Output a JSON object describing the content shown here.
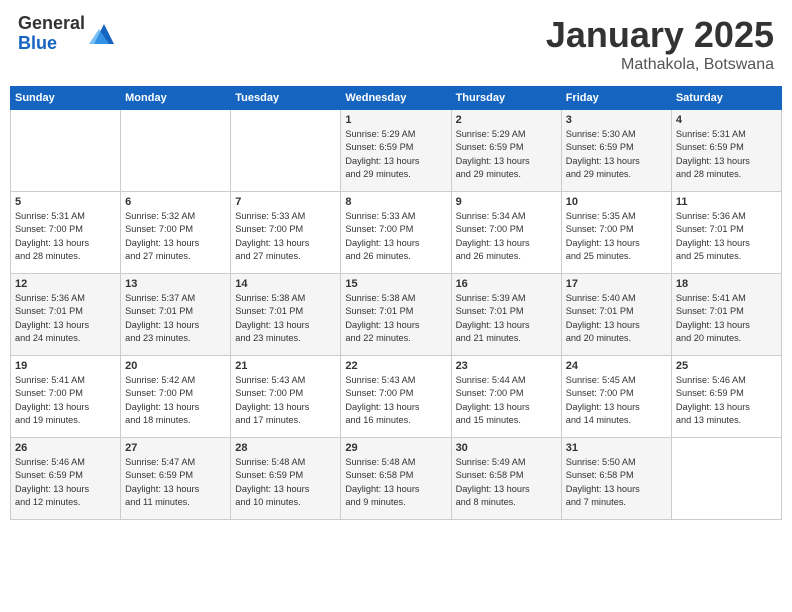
{
  "header": {
    "logo_general": "General",
    "logo_blue": "Blue",
    "month_year": "January 2025",
    "location": "Mathakola, Botswana"
  },
  "days_of_week": [
    "Sunday",
    "Monday",
    "Tuesday",
    "Wednesday",
    "Thursday",
    "Friday",
    "Saturday"
  ],
  "weeks": [
    [
      {
        "day": "",
        "info": ""
      },
      {
        "day": "",
        "info": ""
      },
      {
        "day": "",
        "info": ""
      },
      {
        "day": "1",
        "info": "Sunrise: 5:29 AM\nSunset: 6:59 PM\nDaylight: 13 hours\nand 29 minutes."
      },
      {
        "day": "2",
        "info": "Sunrise: 5:29 AM\nSunset: 6:59 PM\nDaylight: 13 hours\nand 29 minutes."
      },
      {
        "day": "3",
        "info": "Sunrise: 5:30 AM\nSunset: 6:59 PM\nDaylight: 13 hours\nand 29 minutes."
      },
      {
        "day": "4",
        "info": "Sunrise: 5:31 AM\nSunset: 6:59 PM\nDaylight: 13 hours\nand 28 minutes."
      }
    ],
    [
      {
        "day": "5",
        "info": "Sunrise: 5:31 AM\nSunset: 7:00 PM\nDaylight: 13 hours\nand 28 minutes."
      },
      {
        "day": "6",
        "info": "Sunrise: 5:32 AM\nSunset: 7:00 PM\nDaylight: 13 hours\nand 27 minutes."
      },
      {
        "day": "7",
        "info": "Sunrise: 5:33 AM\nSunset: 7:00 PM\nDaylight: 13 hours\nand 27 minutes."
      },
      {
        "day": "8",
        "info": "Sunrise: 5:33 AM\nSunset: 7:00 PM\nDaylight: 13 hours\nand 26 minutes."
      },
      {
        "day": "9",
        "info": "Sunrise: 5:34 AM\nSunset: 7:00 PM\nDaylight: 13 hours\nand 26 minutes."
      },
      {
        "day": "10",
        "info": "Sunrise: 5:35 AM\nSunset: 7:00 PM\nDaylight: 13 hours\nand 25 minutes."
      },
      {
        "day": "11",
        "info": "Sunrise: 5:36 AM\nSunset: 7:01 PM\nDaylight: 13 hours\nand 25 minutes."
      }
    ],
    [
      {
        "day": "12",
        "info": "Sunrise: 5:36 AM\nSunset: 7:01 PM\nDaylight: 13 hours\nand 24 minutes."
      },
      {
        "day": "13",
        "info": "Sunrise: 5:37 AM\nSunset: 7:01 PM\nDaylight: 13 hours\nand 23 minutes."
      },
      {
        "day": "14",
        "info": "Sunrise: 5:38 AM\nSunset: 7:01 PM\nDaylight: 13 hours\nand 23 minutes."
      },
      {
        "day": "15",
        "info": "Sunrise: 5:38 AM\nSunset: 7:01 PM\nDaylight: 13 hours\nand 22 minutes."
      },
      {
        "day": "16",
        "info": "Sunrise: 5:39 AM\nSunset: 7:01 PM\nDaylight: 13 hours\nand 21 minutes."
      },
      {
        "day": "17",
        "info": "Sunrise: 5:40 AM\nSunset: 7:01 PM\nDaylight: 13 hours\nand 20 minutes."
      },
      {
        "day": "18",
        "info": "Sunrise: 5:41 AM\nSunset: 7:01 PM\nDaylight: 13 hours\nand 20 minutes."
      }
    ],
    [
      {
        "day": "19",
        "info": "Sunrise: 5:41 AM\nSunset: 7:00 PM\nDaylight: 13 hours\nand 19 minutes."
      },
      {
        "day": "20",
        "info": "Sunrise: 5:42 AM\nSunset: 7:00 PM\nDaylight: 13 hours\nand 18 minutes."
      },
      {
        "day": "21",
        "info": "Sunrise: 5:43 AM\nSunset: 7:00 PM\nDaylight: 13 hours\nand 17 minutes."
      },
      {
        "day": "22",
        "info": "Sunrise: 5:43 AM\nSunset: 7:00 PM\nDaylight: 13 hours\nand 16 minutes."
      },
      {
        "day": "23",
        "info": "Sunrise: 5:44 AM\nSunset: 7:00 PM\nDaylight: 13 hours\nand 15 minutes."
      },
      {
        "day": "24",
        "info": "Sunrise: 5:45 AM\nSunset: 7:00 PM\nDaylight: 13 hours\nand 14 minutes."
      },
      {
        "day": "25",
        "info": "Sunrise: 5:46 AM\nSunset: 6:59 PM\nDaylight: 13 hours\nand 13 minutes."
      }
    ],
    [
      {
        "day": "26",
        "info": "Sunrise: 5:46 AM\nSunset: 6:59 PM\nDaylight: 13 hours\nand 12 minutes."
      },
      {
        "day": "27",
        "info": "Sunrise: 5:47 AM\nSunset: 6:59 PM\nDaylight: 13 hours\nand 11 minutes."
      },
      {
        "day": "28",
        "info": "Sunrise: 5:48 AM\nSunset: 6:59 PM\nDaylight: 13 hours\nand 10 minutes."
      },
      {
        "day": "29",
        "info": "Sunrise: 5:48 AM\nSunset: 6:58 PM\nDaylight: 13 hours\nand 9 minutes."
      },
      {
        "day": "30",
        "info": "Sunrise: 5:49 AM\nSunset: 6:58 PM\nDaylight: 13 hours\nand 8 minutes."
      },
      {
        "day": "31",
        "info": "Sunrise: 5:50 AM\nSunset: 6:58 PM\nDaylight: 13 hours\nand 7 minutes."
      },
      {
        "day": "",
        "info": ""
      }
    ]
  ]
}
